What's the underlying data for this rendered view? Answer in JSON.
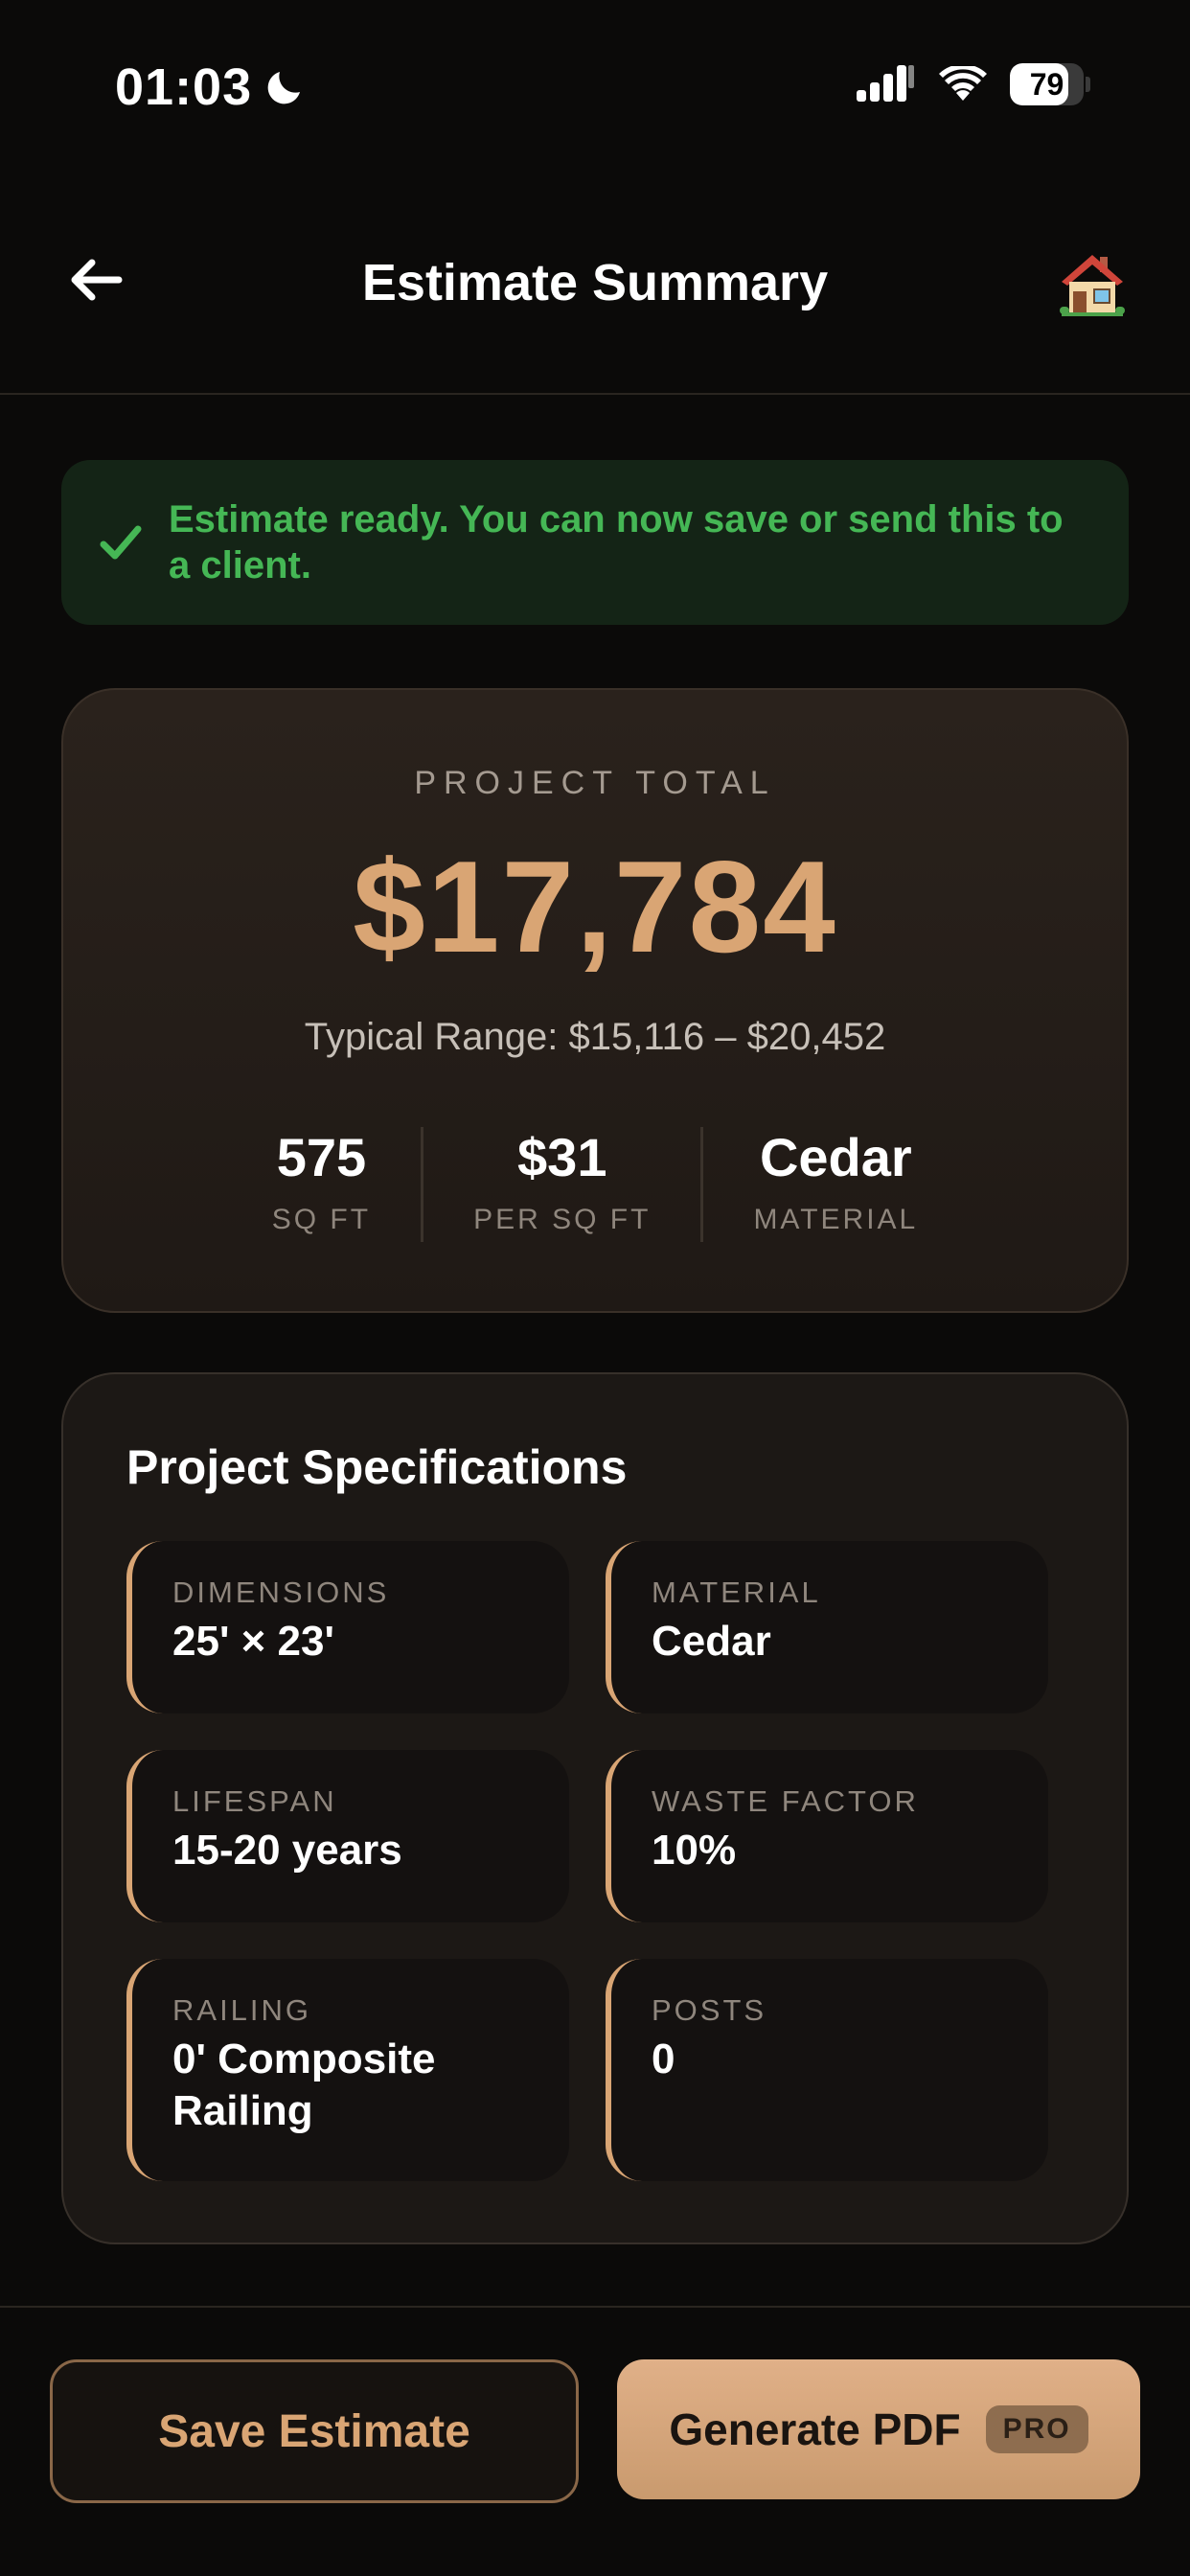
{
  "status_bar": {
    "time": "01:03",
    "battery": "79",
    "battery_level": 0.79
  },
  "nav": {
    "title": "Estimate Summary",
    "back_icon": "arrow-left-icon",
    "home_icon": "house-icon"
  },
  "banner": {
    "text": "Estimate ready. You can now save or send this to a client.",
    "icon": "check-icon",
    "color": "#45b755"
  },
  "total": {
    "label": "PROJECT TOTAL",
    "amount": "$17,784",
    "range": "Typical Range: $15,116 – $20,452",
    "stats": [
      {
        "value": "575",
        "label": "SQ FT"
      },
      {
        "value": "$31",
        "label": "PER SQ FT"
      },
      {
        "value": "Cedar",
        "label": "MATERIAL"
      }
    ],
    "accent": "#d9a574"
  },
  "specs": {
    "title": "Project Specifications",
    "items": [
      {
        "label": "DIMENSIONS",
        "value": "25' × 23'"
      },
      {
        "label": "MATERIAL",
        "value": "Cedar"
      },
      {
        "label": "LIFESPAN",
        "value": "15-20 years"
      },
      {
        "label": "WASTE FACTOR",
        "value": "10%"
      },
      {
        "label": "RAILING",
        "value": "0' Composite Railing"
      },
      {
        "label": "POSTS",
        "value": "0"
      }
    ]
  },
  "footer": {
    "save_label": "Save Estimate",
    "pdf_label": "Generate PDF",
    "pro_badge": "PRO"
  }
}
